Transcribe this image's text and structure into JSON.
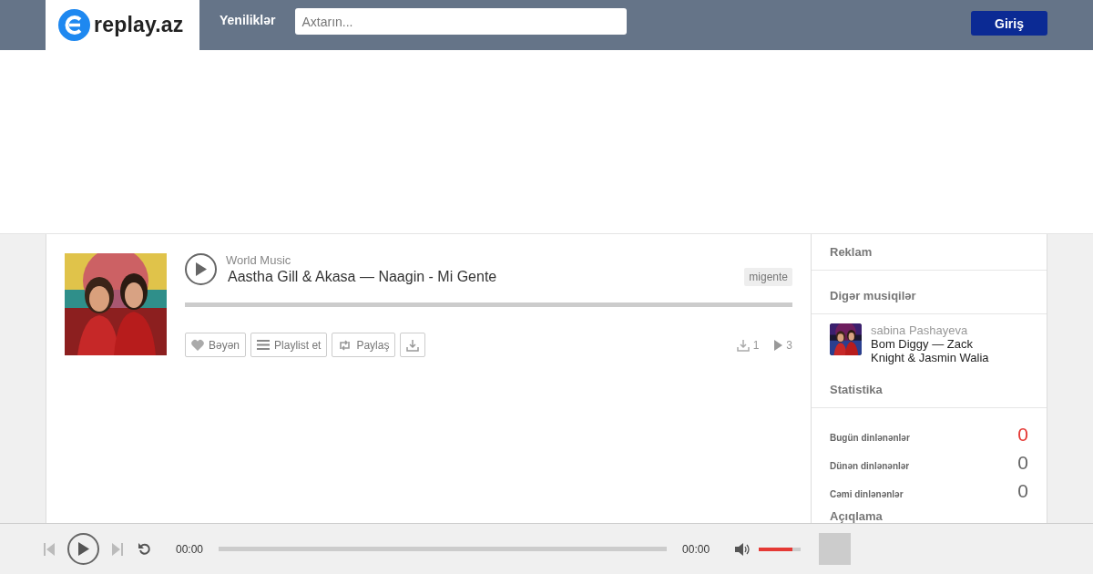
{
  "header": {
    "logo": "replay.az",
    "nav": [
      {
        "label": "Yeniliklər"
      }
    ],
    "search": {
      "placeholder": "Axtarın..."
    },
    "login": "Giriş"
  },
  "track": {
    "genre": "World Music",
    "title": "Aastha Gill & Akasa — Naagin - Mi Gente",
    "tag": "migente",
    "progress": {
      "level": 0
    },
    "actions": [
      {
        "kind": "like",
        "label": "Bəyən"
      },
      {
        "kind": "playlist",
        "label": "Playlist et"
      },
      {
        "kind": "share",
        "label": "Paylaş"
      },
      {
        "kind": "download"
      }
    ],
    "downloads": "1",
    "plays": "3"
  },
  "sidebar": {
    "ad_heading": "Reklam",
    "other_heading": "Digər musiqilər",
    "other": [
      {
        "user": "sabina Pashayeva",
        "title": "Bom Diggy — Zack Knight & Jasmin Walia"
      }
    ],
    "stats_heading": "Statistika",
    "stats": [
      {
        "label": "Bugün dinlənənlər",
        "value": "0",
        "color": "#e53935"
      },
      {
        "label": "Dünən dinlənənlər",
        "value": "0",
        "color": "#666666"
      },
      {
        "label": "Cəmi dinlənənlər",
        "value": "0",
        "color": "#666666"
      }
    ],
    "description_heading": "Açıqlama"
  },
  "player": {
    "elapsed": "00:00",
    "progress": {
      "level": 0
    },
    "duration": "00:00",
    "volume": {
      "level": 0.8
    }
  }
}
